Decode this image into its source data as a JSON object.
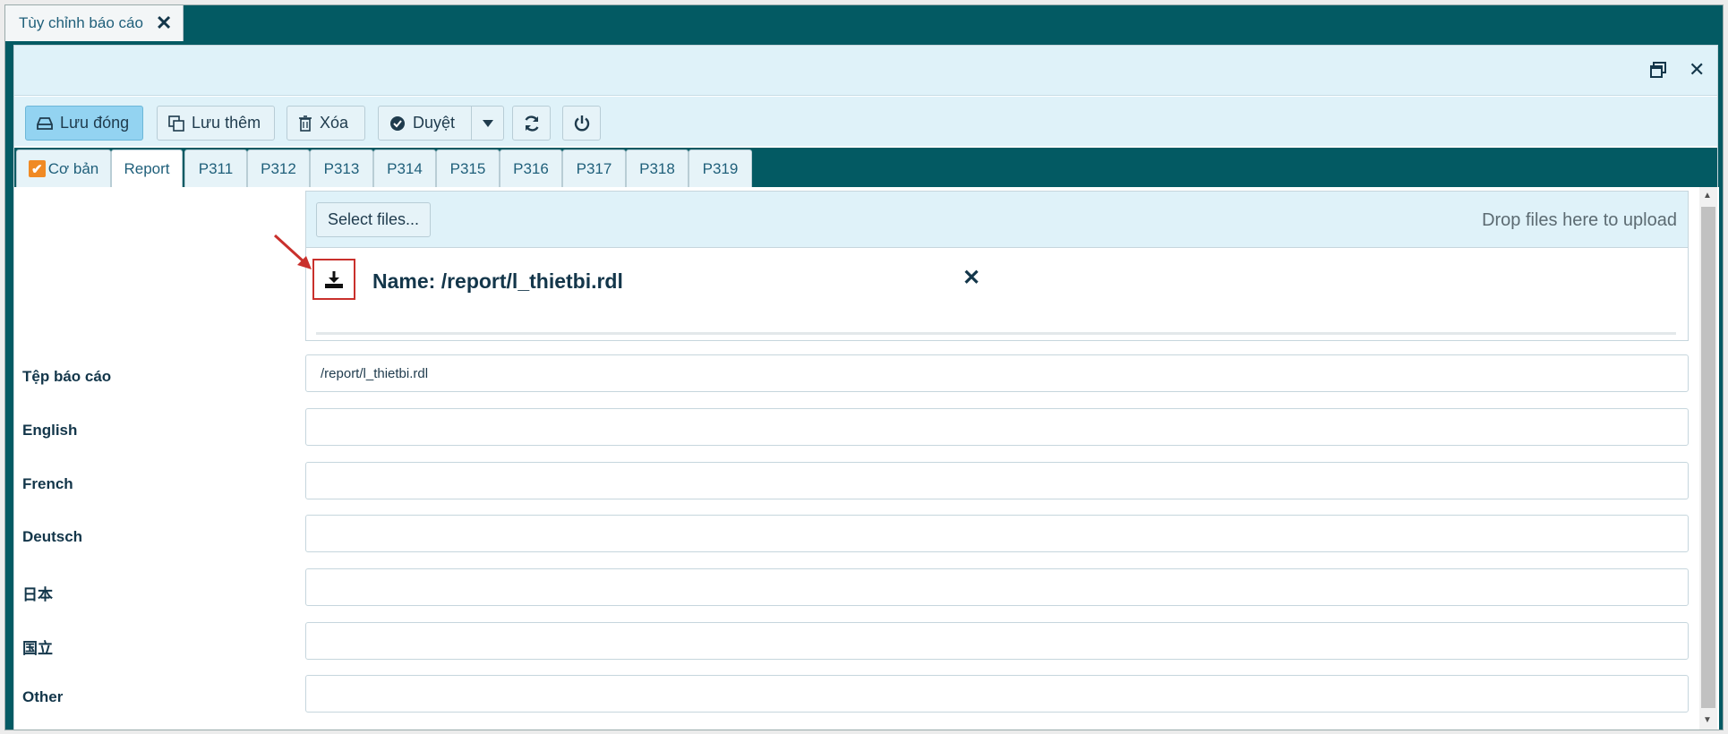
{
  "top_tab": {
    "label": "Tùy chỉnh báo cáo",
    "close_icon": "close-icon"
  },
  "window": {
    "restore_icon": "restore-window-icon",
    "close_icon": "close-icon"
  },
  "toolbar": {
    "save_close_label": "Lưu đóng",
    "save_more_label": "Lưu thêm",
    "delete_label": "Xóa",
    "approve_label": "Duyệt"
  },
  "tabs": [
    {
      "label": "Cơ bản",
      "checked": true
    },
    {
      "label": "Report",
      "active": true
    },
    {
      "label": "P311"
    },
    {
      "label": "P312"
    },
    {
      "label": "P313"
    },
    {
      "label": "P314"
    },
    {
      "label": "P315"
    },
    {
      "label": "P316"
    },
    {
      "label": "P317"
    },
    {
      "label": "P318"
    },
    {
      "label": "P319"
    }
  ],
  "upload": {
    "select_label": "Select files...",
    "drop_hint": "Drop files here to upload",
    "file_name": "Name: /report/l_thietbi.rdl",
    "file_icon": "download-icon",
    "remove_icon": "close-icon"
  },
  "form": {
    "rows": [
      {
        "label": "Tệp báo cáo",
        "value": "/report/l_thietbi.rdl"
      },
      {
        "label": "English",
        "value": ""
      },
      {
        "label": "French",
        "value": ""
      },
      {
        "label": "Deutsch",
        "value": ""
      },
      {
        "label": "日本",
        "value": ""
      },
      {
        "label": "国立",
        "value": ""
      },
      {
        "label": "Other",
        "value": ""
      }
    ]
  },
  "colors": {
    "brand_teal": "#035a63",
    "panel_blue": "#dff2f9",
    "primary_button": "#93d3f1",
    "checkbox_orange": "#f08a24",
    "annotation_red": "#c9302c"
  }
}
